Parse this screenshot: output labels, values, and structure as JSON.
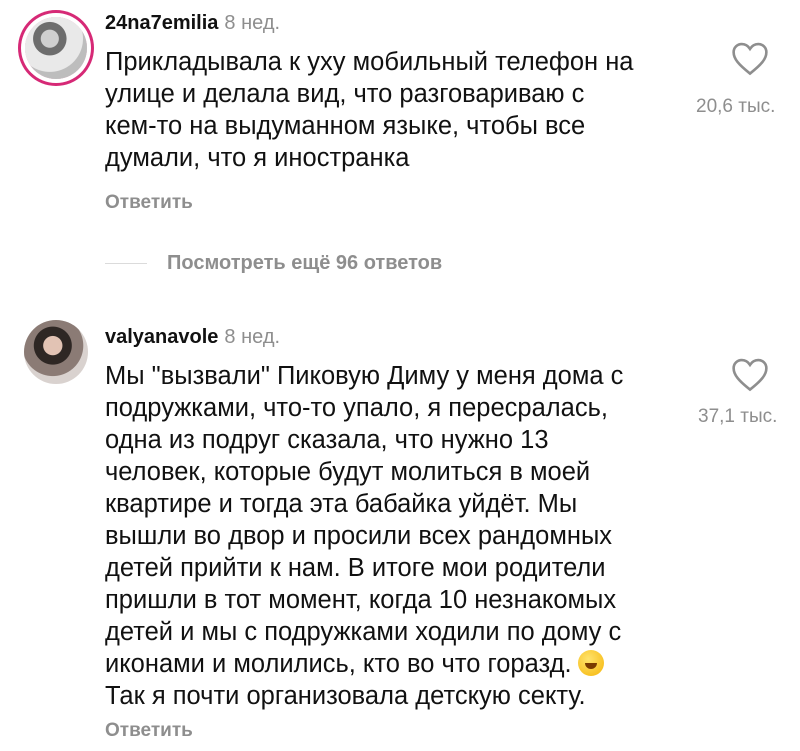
{
  "comments": [
    {
      "username": "24na7emilia",
      "time": "8 нед.",
      "text_lines": [
        "Прикладывала к уху мобильный телефон на",
        "улице и делала вид, что разговариваю с",
        "кем-то на выдуманном языке, чтобы все",
        "думали, что я иностранка"
      ],
      "reply_label": "Ответить",
      "likes": "20,6 тыс.",
      "avatar_story_ring": true
    },
    {
      "username": "valyanavole",
      "time": "8 нед.",
      "text_lines": [
        "Мы \"вызвали\" Пиковую Диму у меня дома с",
        "подружками, что-то упало, я пересралась,",
        "одна из подруг сказала, что нужно 13",
        "человек, которые будут молиться в моей",
        "квартире и тогда эта бабайка уйдёт. Мы",
        "вышли во двор и просили всех рандомных",
        "детей прийти к нам. В итоге мои родители",
        "пришли в тот момент, когда 10 незнакомых",
        "детей и мы с подружками ходили по дому с",
        "иконами и молились, кто во что горазд.",
        "Так я почти организовала детскую секту."
      ],
      "emoji": "rolling-on-floor-laughing",
      "reply_label": "Ответить",
      "likes": "37,1 тыс.",
      "avatar_story_ring": false
    }
  ],
  "view_more_replies": "Посмотреть ещё 96 ответов",
  "colors": {
    "text": "#111111",
    "secondary": "#8e8e8e",
    "story_ring": "#d62976",
    "divider": "#dbdbdb"
  },
  "icons": {
    "like": "heart-outline-icon",
    "emoji": "rolling-laughing-emoji-icon"
  }
}
